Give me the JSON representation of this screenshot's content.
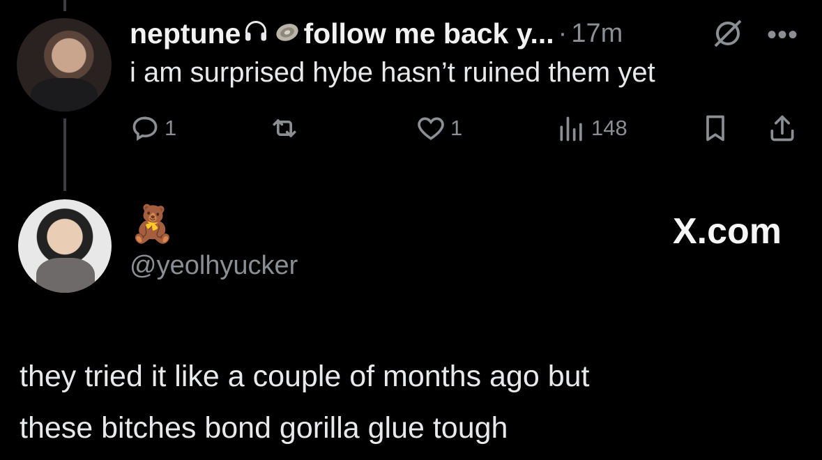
{
  "original_tweet": {
    "author_name": "neptune",
    "name_suffix": "follow me back y...",
    "separator": "·",
    "timestamp": "17m",
    "icons": [
      "headphones-icon",
      "oyster-icon",
      "grok-icon",
      "more-icon"
    ],
    "text": "i am surprised hybe hasn’t ruined them yet",
    "actions": {
      "reply_count": "1",
      "retweet_count": "",
      "like_count": "1",
      "views_count": "148"
    }
  },
  "quoted_reply": {
    "emoji": "🧸",
    "handle": "@yeolhyucker",
    "source": "X.com",
    "lines": [
      "they tried it like a couple of months ago but",
      "these bitches bond gorilla glue tough"
    ]
  },
  "colors": {
    "background": "#000000",
    "primary_text": "#e7e9ea",
    "muted_text": "#8b8f94",
    "thread_line": "#3a3d41"
  }
}
